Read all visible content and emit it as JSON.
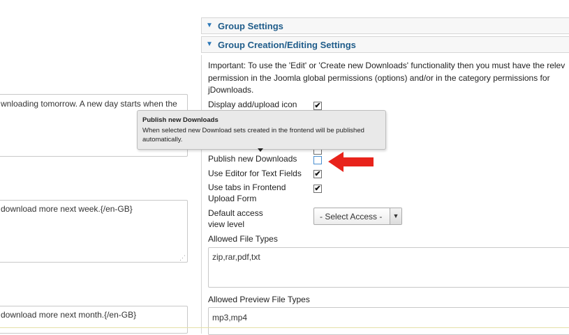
{
  "left_fields": {
    "field1_text": "wnloading tomorrow. A new day starts when the",
    "field2_text": "download more next week.{/en-GB}",
    "field3_text": "download more next month.{/en-GB}"
  },
  "sections": {
    "group_settings": "Group Settings",
    "group_creation": "Group Creation/Editing Settings"
  },
  "note": {
    "line1": "Important: To use the 'Edit' or 'Create new Downloads' functionality then you must have the relev",
    "line2": "permission in the Joomla global permissions (options) and/or in the category permissions for",
    "line3": "jDownloads."
  },
  "settings": {
    "display_add_upload_icon": {
      "label": "Display add/upload icon",
      "checked": true
    },
    "hidden_row": {
      "checked": false
    },
    "publish_new_downloads": {
      "label": "Publish new Downloads",
      "checked": false
    },
    "use_editor": {
      "label": "Use Editor for Text Fields",
      "checked": true
    },
    "use_tabs_line1": "Use tabs in Frontend",
    "use_tabs_line2": "Upload Form",
    "use_tabs_checked": true,
    "access_line1": "Default access",
    "access_line2": "view level",
    "access_select_value": "- Select Access -"
  },
  "allowed_file_types": {
    "label": "Allowed File Types",
    "value": "zip,rar,pdf,txt"
  },
  "allowed_preview_types": {
    "label": "Allowed Preview File Types",
    "value": "mp3,mp4"
  },
  "tooltip": {
    "title": "Publish new Downloads",
    "body": "When selected new Download sets created in the frontend will be published automatically."
  },
  "glyphs": {
    "check": "✔",
    "triangle": "▼",
    "grip": "⋰",
    "select_arrow": "▼"
  },
  "colors": {
    "header_text": "#1f5c8a",
    "arrow": "#e8231b",
    "checkbox_focus": "#4a8fd0"
  }
}
